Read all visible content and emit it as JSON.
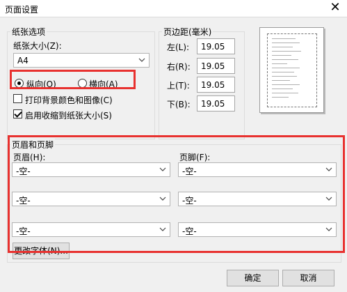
{
  "window": {
    "title": "页面设置",
    "close_glyph": "✕"
  },
  "paper": {
    "group_title": "纸张选项",
    "size_label": "纸张大小(Z):",
    "size_value": "A4",
    "portrait_label": "纵向(O)",
    "landscape_label": "横向(A)",
    "print_background_label": "打印背景颜色和图像(C)",
    "shrink_label": "启用收缩到纸张大小(S)",
    "orientation": "portrait",
    "print_background_checked": false,
    "shrink_checked": true
  },
  "margins": {
    "group_title": "页边距(毫米)",
    "left_label": "左(L):",
    "left_value": "19.05",
    "right_label": "右(R):",
    "right_value": "19.05",
    "top_label": "上(T):",
    "top_value": "19.05",
    "bottom_label": "下(B):",
    "bottom_value": "19.05"
  },
  "header_footer": {
    "group_title": "页眉和页脚",
    "header_label": "页眉(H):",
    "footer_label": "页脚(F):",
    "header_values": [
      "-空-",
      "-空-",
      "-空-"
    ],
    "footer_values": [
      "-空-",
      "-空-",
      "-空-"
    ],
    "font_button": "更改字体(N)..."
  },
  "buttons": {
    "ok": "确定",
    "cancel": "取消"
  },
  "colors": {
    "highlight": "#e8312f",
    "background": "#f0f0f0"
  },
  "icons": {
    "dropdown": "chevron-down-icon"
  }
}
